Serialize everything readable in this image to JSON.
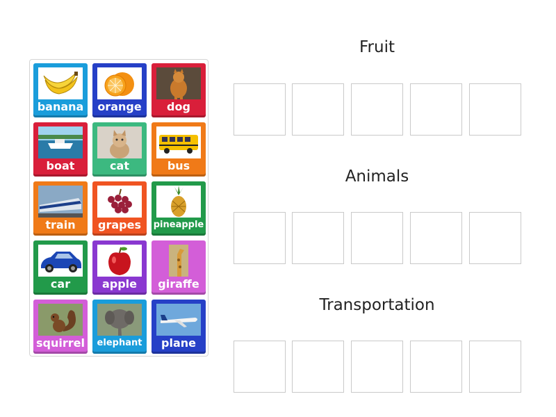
{
  "tiles": [
    {
      "label": "banana",
      "color": "#1a9ddb",
      "icon": "banana-icon"
    },
    {
      "label": "orange",
      "color": "#2640c7",
      "icon": "orange-icon"
    },
    {
      "label": "dog",
      "color": "#d91f3a",
      "icon": "dog-icon"
    },
    {
      "label": "boat",
      "color": "#d91f3a",
      "icon": "boat-icon"
    },
    {
      "label": "cat",
      "color": "#3cb980",
      "icon": "cat-icon"
    },
    {
      "label": "bus",
      "color": "#f07a18",
      "icon": "bus-icon"
    },
    {
      "label": "train",
      "color": "#f07a18",
      "icon": "train-icon"
    },
    {
      "label": "grapes",
      "color": "#f05422",
      "icon": "grapes-icon"
    },
    {
      "label": "pineapple",
      "color": "#229a4a",
      "icon": "pineapple-icon"
    },
    {
      "label": "car",
      "color": "#229a4a",
      "icon": "car-icon"
    },
    {
      "label": "apple",
      "color": "#8a38d0",
      "icon": "apple-icon"
    },
    {
      "label": "giraffe",
      "color": "#d35ed8",
      "icon": "giraffe-icon"
    },
    {
      "label": "squirrel",
      "color": "#d35ed8",
      "icon": "squirrel-icon"
    },
    {
      "label": "elephant",
      "color": "#1a9ddb",
      "icon": "elephant-icon"
    },
    {
      "label": "plane",
      "color": "#2640c7",
      "icon": "plane-icon"
    }
  ],
  "categories": [
    {
      "title": "Fruit",
      "slots": 5
    },
    {
      "title": "Animals",
      "slots": 5
    },
    {
      "title": "Transportation",
      "slots": 5
    }
  ]
}
